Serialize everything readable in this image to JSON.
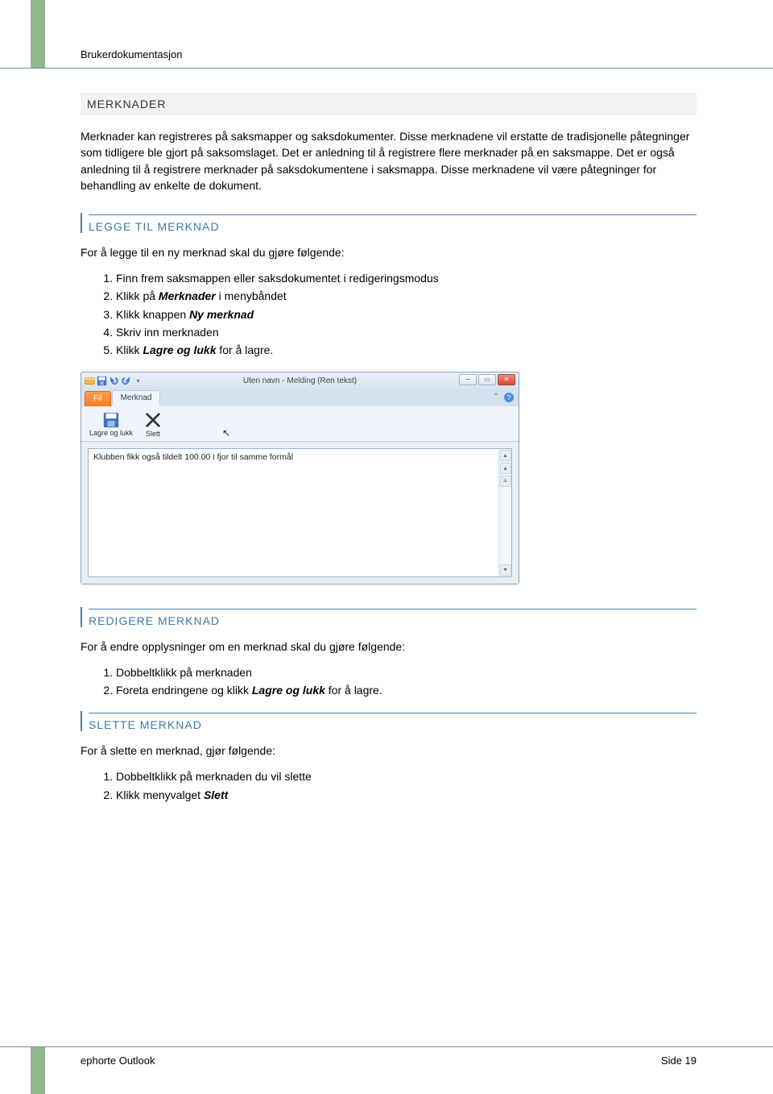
{
  "header": {
    "doc_title": "Brukerdokumentasjon"
  },
  "section": {
    "title": "MERKNADER",
    "intro": "Merknader kan registreres på saksmapper og saksdokumenter. Disse merknadene vil erstatte de tradisjonelle påtegninger som tidligere ble gjort på saksomslaget. Det er anledning til å registrere flere merknader på en saksmappe. Det er også anledning til å registrere merknader på saksdokumentene i saksmappa. Disse merknadene vil være påtegninger for behandling av enkelte de dokument."
  },
  "add": {
    "heading": "LEGGE TIL MERKNAD",
    "intro": "For å legge til en ny merknad skal du gjøre følgende:",
    "steps": {
      "s1": "Finn frem saksmappen eller saksdokumentet i redigeringsmodus",
      "s2a": "Klikk på ",
      "s2b": "Merknader",
      "s2c": " i menybåndet",
      "s3a": "Klikk knappen ",
      "s3b": "Ny merknad",
      "s4": "Skriv inn merknaden",
      "s5a": "Klikk ",
      "s5b": "Lagre og lukk",
      "s5c": " for å lagre."
    }
  },
  "window": {
    "title": "Uten navn - Melding (Ren tekst)",
    "tab_file": "Fil",
    "tab_active": "Merknad",
    "btn_save": "Lagre og lukk",
    "btn_delete": "Slett",
    "text_content": "Klubben fikk også tildelt 100.00 i fjor til samme formål"
  },
  "edit": {
    "heading": "REDIGERE MERKNAD",
    "intro": "For å endre opplysninger om en merknad skal du gjøre følgende:",
    "steps": {
      "s1": "Dobbeltklikk på merknaden",
      "s2a": "Foreta endringene og klikk ",
      "s2b": "Lagre og lukk",
      "s2c": " for å lagre."
    }
  },
  "delete": {
    "heading": "SLETTE MERKNAD",
    "intro": "For å slette en merknad, gjør følgende:",
    "steps": {
      "s1": "Dobbeltklikk på merknaden du vil slette",
      "s2a": "Klikk menyvalget ",
      "s2b": "Slett"
    }
  },
  "footer": {
    "left": "ephorte Outlook",
    "right": "Side 19"
  }
}
